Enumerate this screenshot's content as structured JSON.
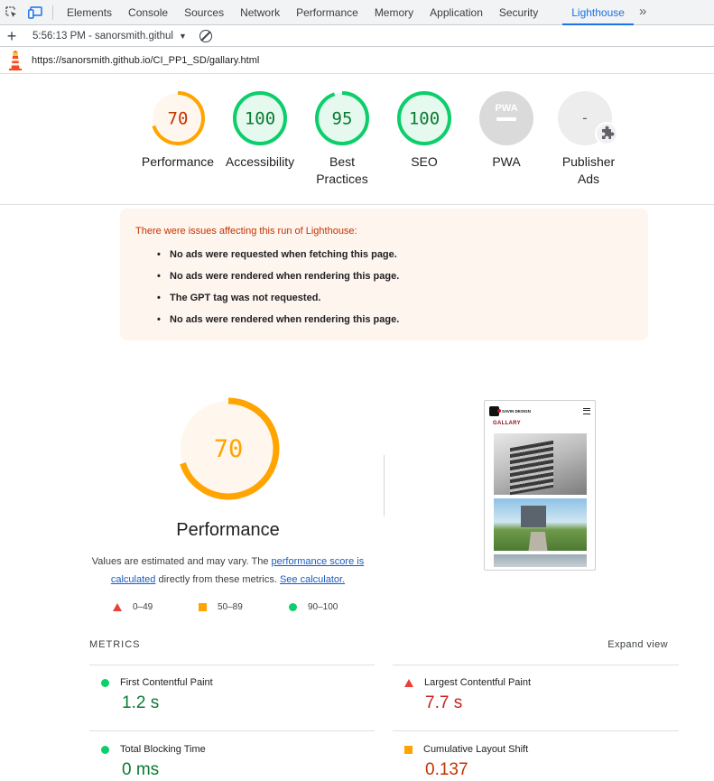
{
  "devtools": {
    "tabs": [
      "Elements",
      "Console",
      "Sources",
      "Network",
      "Performance",
      "Memory",
      "Application",
      "Security"
    ],
    "active_tab": "Lighthouse",
    "more": "»"
  },
  "toolbar": {
    "add": "+",
    "report": "5:56:13 PM - sanorsmith.githul",
    "caret": "▼"
  },
  "url": "https://sanorsmith.github.io/CI_PP1_SD/gallary.html",
  "gauges": [
    {
      "score": "70",
      "label": "Performance",
      "value": 0.7,
      "color": "#ffa400",
      "text_color": "#c33300"
    },
    {
      "score": "100",
      "label": "Accessibility",
      "value": 1.0,
      "color": "#0cce6b",
      "text_color": "#0a7b33"
    },
    {
      "score": "95",
      "label": "Best Practices",
      "value": 0.95,
      "color": "#0cce6b",
      "text_color": "#0a7b33"
    },
    {
      "score": "100",
      "label": "SEO",
      "value": 1.0,
      "color": "#0cce6b",
      "text_color": "#0a7b33"
    },
    {
      "score": "PWA",
      "label": "PWA",
      "value": 0,
      "color": "#d9d9d9",
      "text_color": "#ffffff"
    },
    {
      "score": "-",
      "label": "Publisher Ads",
      "value": 0,
      "color": "#ededed",
      "text_color": "#5f6368"
    }
  ],
  "warning": {
    "title": "There were issues affecting this run of Lighthouse:",
    "items": [
      "No ads were requested when fetching this page.",
      "No ads were rendered when rendering this page.",
      "The GPT tag was not requested.",
      "No ads were rendered when rendering this page."
    ]
  },
  "performance": {
    "score": "70",
    "value": 0.7,
    "title": "Performance",
    "desc_part1": "Values are estimated and may vary. The ",
    "link1": "performance score is calculated",
    "desc_part2": " directly from these metrics. ",
    "link2": "See calculator."
  },
  "legend": [
    {
      "range": "0–49",
      "shape": "triangle",
      "color": "#e8403a"
    },
    {
      "range": "50–89",
      "shape": "square",
      "color": "#ffa400"
    },
    {
      "range": "90–100",
      "shape": "circle",
      "color": "#0cce6b"
    }
  ],
  "thumbnail": {
    "brand": "SAVIN DESIGN",
    "heading": "GALLARY"
  },
  "metrics": {
    "heading": "METRICS",
    "expand": "Expand view",
    "items": [
      {
        "name": "First Contentful Paint",
        "value": "1.2 s",
        "status": "good"
      },
      {
        "name": "Largest Contentful Paint",
        "value": "7.7 s",
        "status": "bad"
      },
      {
        "name": "Total Blocking Time",
        "value": "0 ms",
        "status": "good"
      },
      {
        "name": "Cumulative Layout Shift",
        "value": "0.137",
        "status": "average"
      }
    ]
  }
}
